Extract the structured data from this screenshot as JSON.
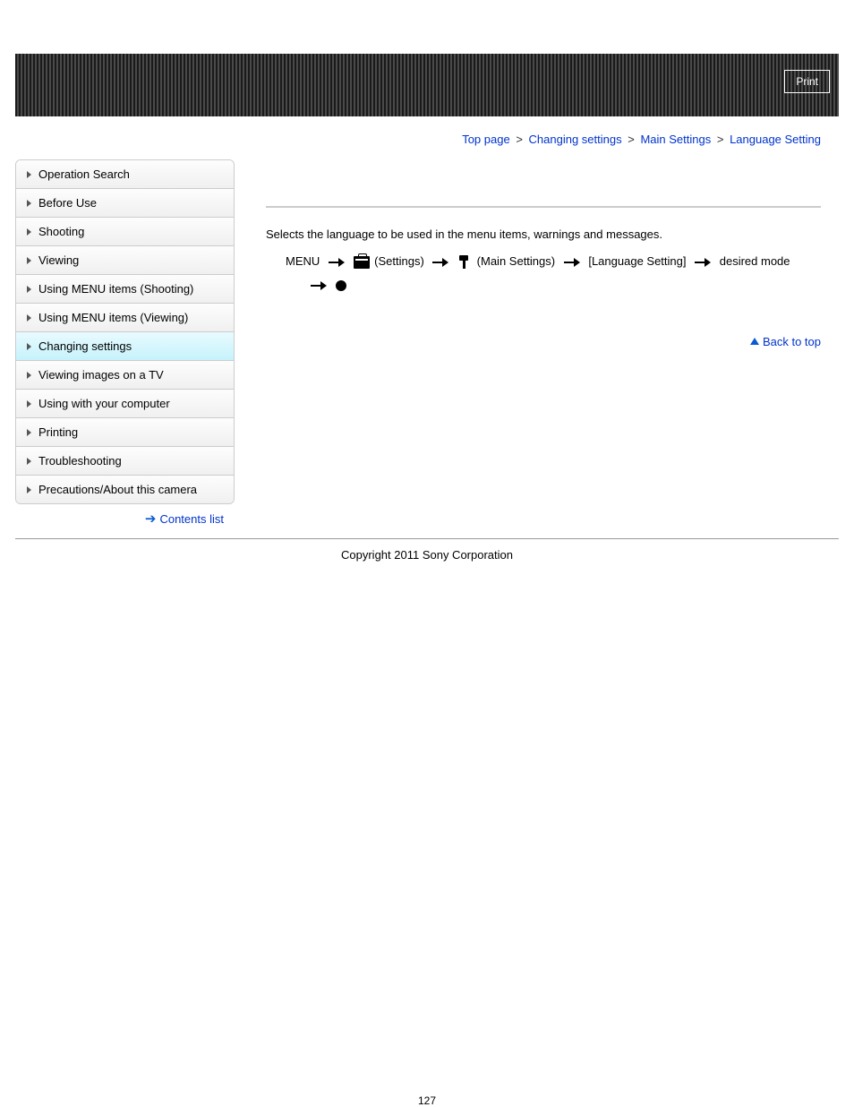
{
  "header": {
    "print_label": "Print"
  },
  "breadcrumb": {
    "top": "Top page",
    "b1": "Changing settings",
    "b2": "Main Settings",
    "current": "Language Setting",
    "sep": ">"
  },
  "sidebar": {
    "items": [
      {
        "label": "Operation Search",
        "active": false
      },
      {
        "label": "Before Use",
        "active": false
      },
      {
        "label": "Shooting",
        "active": false
      },
      {
        "label": "Viewing",
        "active": false
      },
      {
        "label": "Using MENU items (Shooting)",
        "active": false
      },
      {
        "label": "Using MENU items (Viewing)",
        "active": false
      },
      {
        "label": "Changing settings",
        "active": true
      },
      {
        "label": "Viewing images on a TV",
        "active": false
      },
      {
        "label": "Using with your computer",
        "active": false
      },
      {
        "label": "Printing",
        "active": false
      },
      {
        "label": "Troubleshooting",
        "active": false
      },
      {
        "label": "Precautions/About this camera",
        "active": false
      }
    ]
  },
  "contents_link": "Contents list",
  "main": {
    "description": "Selects the language to be used in the menu items, warnings and messages.",
    "path_menu": "MENU",
    "path_settings": "(Settings)",
    "path_main_settings": "(Main Settings)",
    "path_language": "[Language Setting]",
    "path_desired": "desired mode"
  },
  "back_to_top": "Back to top",
  "copyright": "Copyright 2011 Sony Corporation",
  "page_number": "127"
}
